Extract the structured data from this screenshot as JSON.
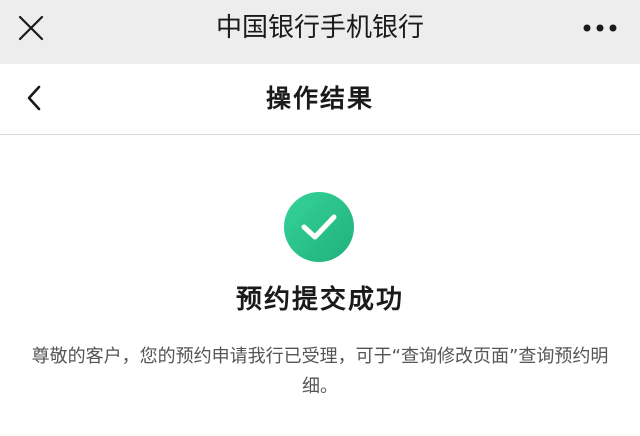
{
  "topbar": {
    "title": "中国银行手机银行",
    "close_icon": "close-icon",
    "more_icon": "more-icon"
  },
  "navbar": {
    "title": "操作结果",
    "back_icon": "chevron-left-icon"
  },
  "result": {
    "status_icon": "check-circle-icon",
    "title": "预约提交成功",
    "message": "尊敬的客户，您的预约申请我行已受理，可于“查询修改页面”查询预约明细。"
  },
  "colors": {
    "topbar_bg": "#ededed",
    "success_green": "#1fb07c",
    "text_primary": "#1a1a1a",
    "text_secondary": "#555555"
  }
}
